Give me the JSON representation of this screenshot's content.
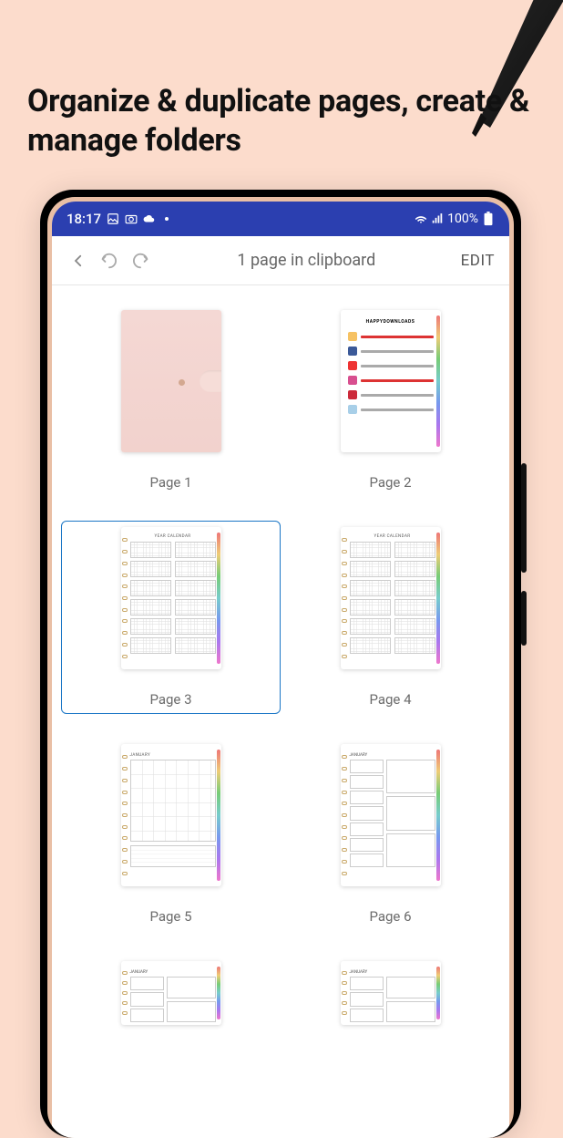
{
  "promo": {
    "headline": "Organize & duplicate pages, create & manage folders"
  },
  "status_bar": {
    "time": "18:17",
    "battery_text": "100%"
  },
  "toolbar": {
    "title": "1 page in clipboard",
    "edit_label": "EDIT"
  },
  "pages": {
    "selected_index": 2,
    "items": [
      {
        "label": "Page 1"
      },
      {
        "label": "Page 2"
      },
      {
        "label": "Page 3"
      },
      {
        "label": "Page 4"
      },
      {
        "label": "Page 5"
      },
      {
        "label": "Page 6"
      }
    ]
  },
  "thumbs": {
    "social_header": "HAPPYDOWNLOADS",
    "calendar_title": "YEAR CALENDAR",
    "month_title": "JANUARY"
  }
}
